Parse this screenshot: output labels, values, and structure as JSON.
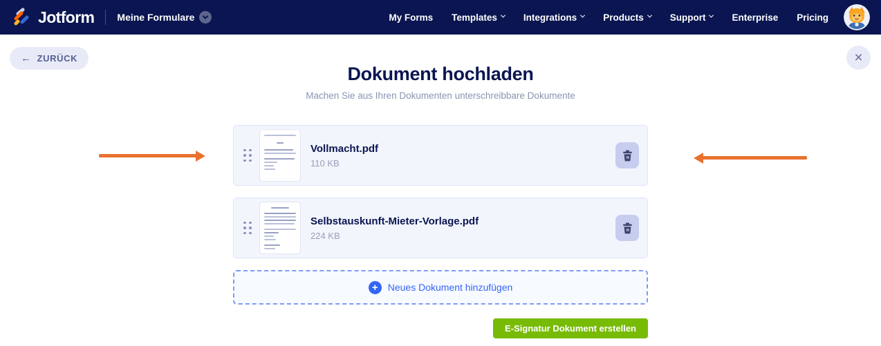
{
  "colors": {
    "navbar_bg": "#0a1551",
    "navy_text": "#0a1551",
    "accent_green": "#78bb07",
    "accent_blue": "#3365f6",
    "arrow_orange": "#e8722e",
    "card_bg": "#f2f5fc",
    "pill_bg": "#e8ebf7"
  },
  "nav": {
    "brand": "Jotform",
    "workspace": "Meine Formulare",
    "items": [
      {
        "label": "My Forms",
        "dropdown": false
      },
      {
        "label": "Templates",
        "dropdown": true
      },
      {
        "label": "Integrations",
        "dropdown": true
      },
      {
        "label": "Products",
        "dropdown": true
      },
      {
        "label": "Support",
        "dropdown": true
      },
      {
        "label": "Enterprise",
        "dropdown": false
      },
      {
        "label": "Pricing",
        "dropdown": false
      }
    ]
  },
  "page": {
    "back_icon": "←",
    "back_label": "ZURÜCK",
    "close_icon": "×",
    "title": "Dokument hochladen",
    "subtitle": "Machen Sie aus Ihren Dokumenten unterschreibbare Dokumente",
    "files": [
      {
        "name": "Vollmacht.pdf",
        "size": "110 KB"
      },
      {
        "name": "Selbstauskunft-Mieter-Vorlage.pdf",
        "size": "224 KB"
      }
    ],
    "plus_icon": "+",
    "add_button": "Neues Dokument hinzufügen",
    "submit_button": "E-Signatur Dokument erstellen"
  }
}
